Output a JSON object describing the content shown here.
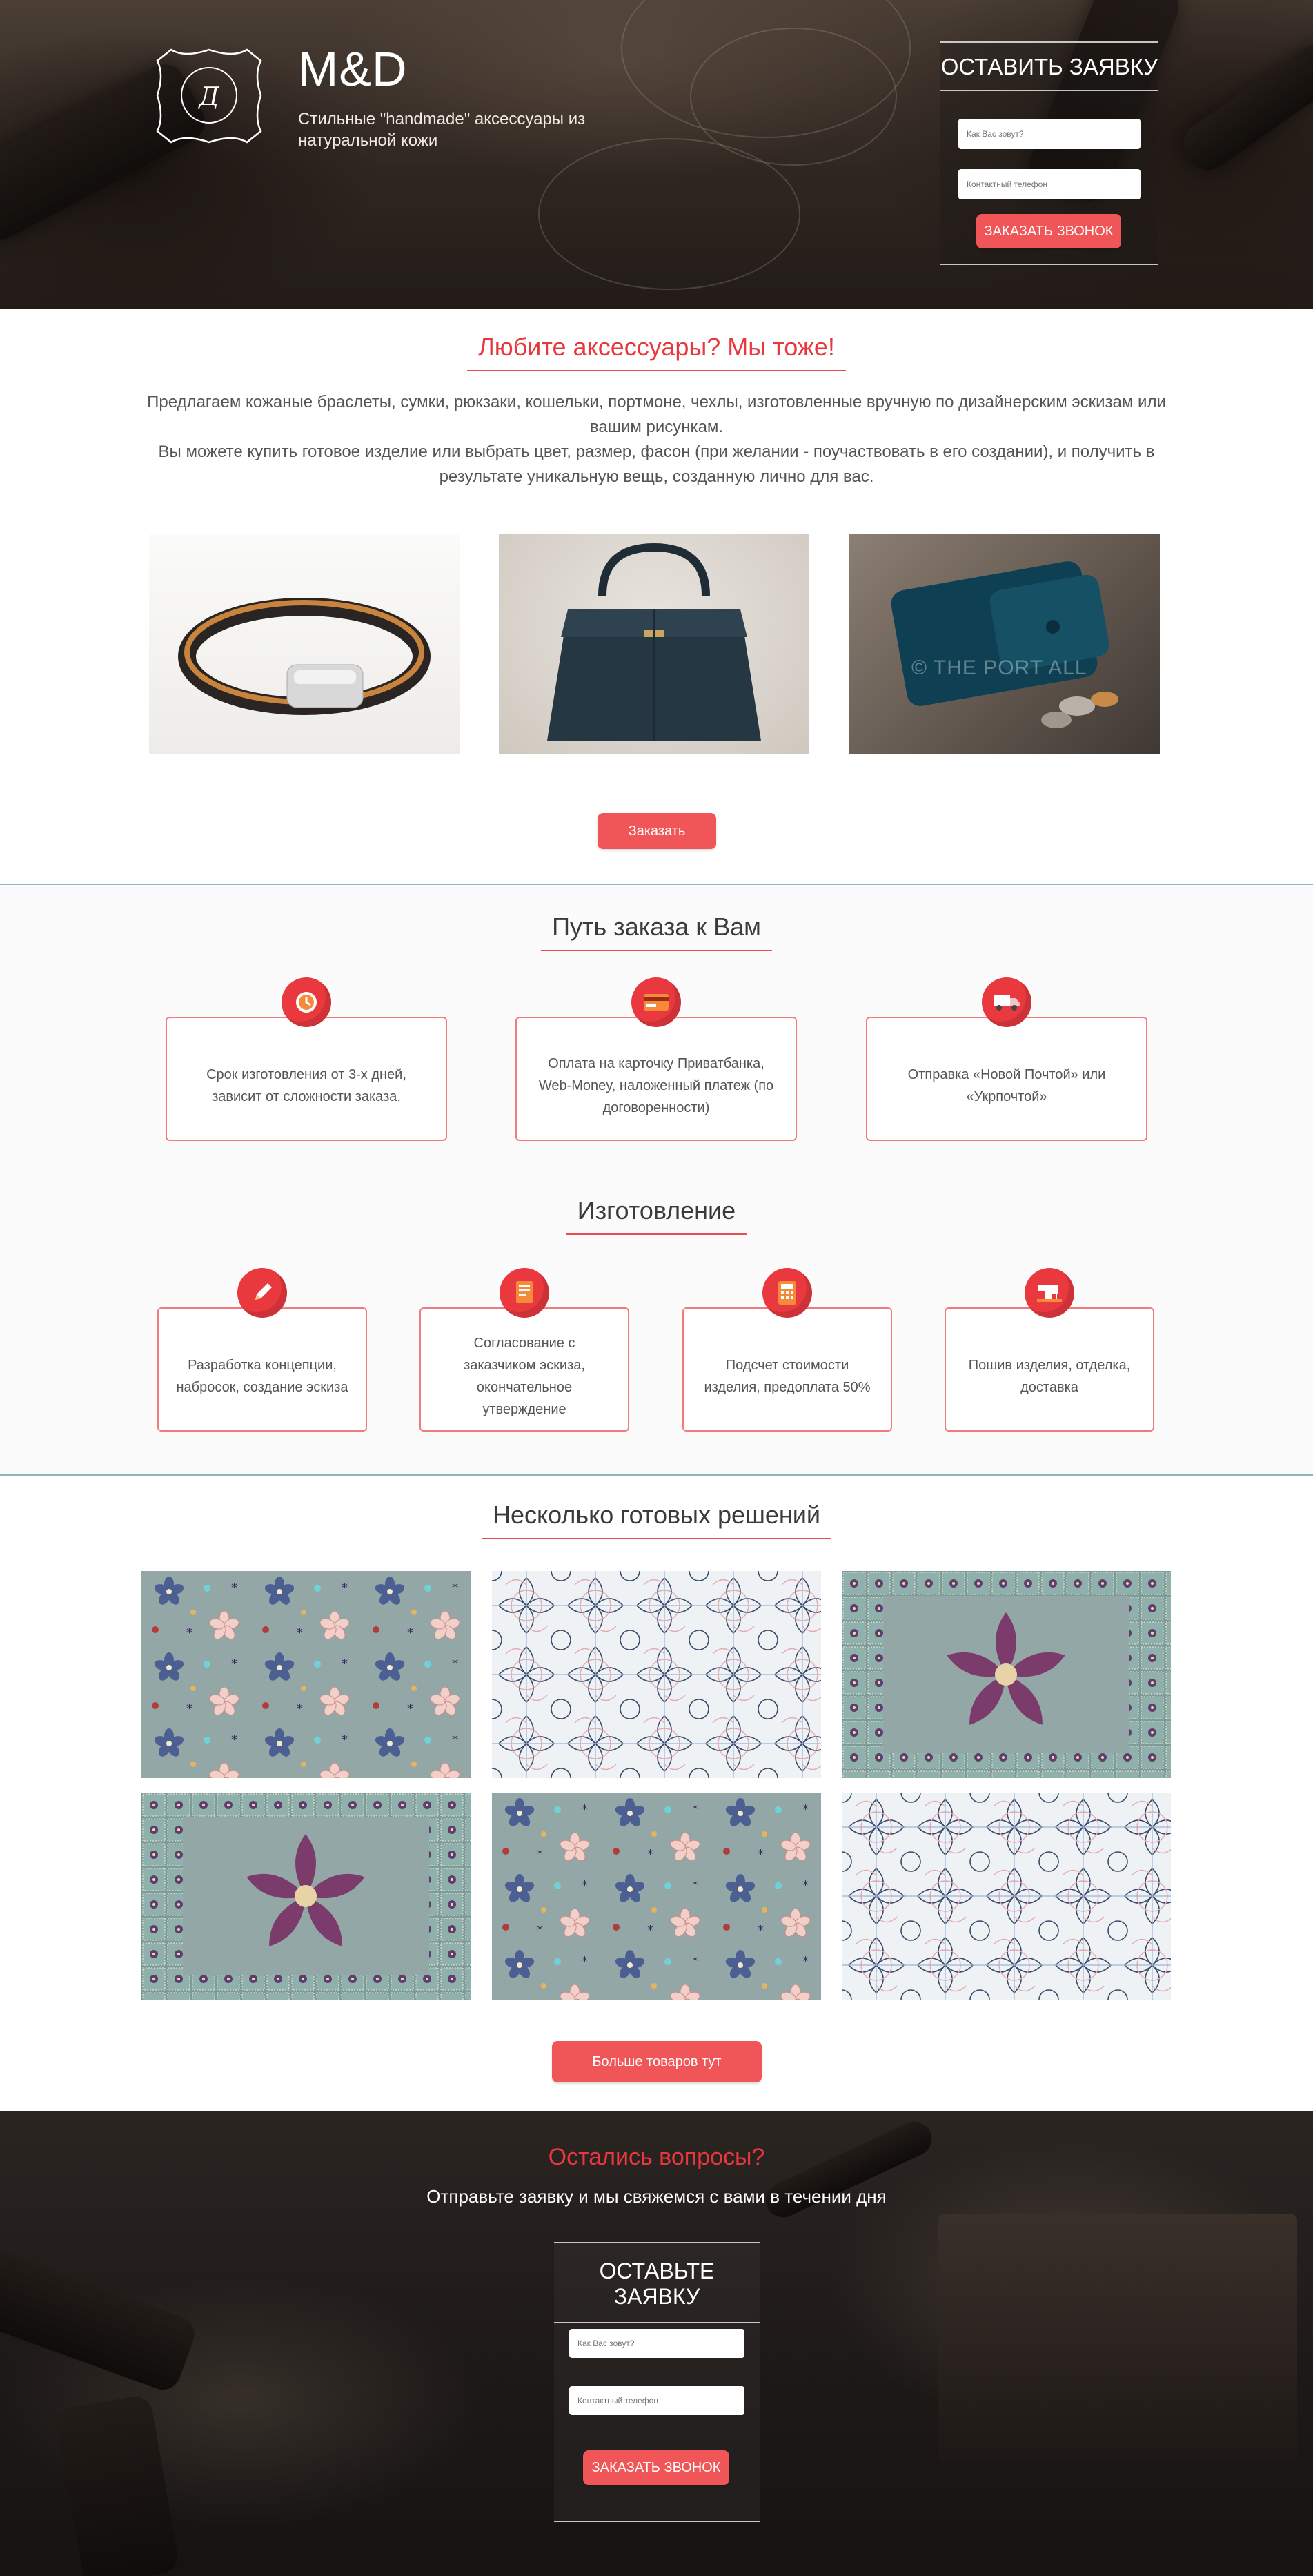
{
  "header": {
    "brand_name": "M&D",
    "tagline": "Стильные \"handmade\" аксессуары из натуральной кожи",
    "form": {
      "title": "ОСТАВИТЬ ЗАЯВКУ",
      "name_placeholder": "Как Вас зовут?",
      "phone_placeholder": "Контактный телефон",
      "submit_label": "ЗАКАЗАТЬ ЗВОНОК"
    }
  },
  "intro": {
    "title": "Любите аксессуары? Мы тоже!",
    "paragraph_1": "Предлагаем кожаные браслеты, сумки, рюкзаки, кошельки, портмоне, чехлы, изготовленные вручную по дизайнерским эскизам или вашим рисункам.",
    "paragraph_2": "Вы можете купить готовое изделие или выбрать цвет, размер, фасон (при желании - поучаствовать в его создании), и получить в результате уникальную вещь, созданную лично для вас.",
    "photos": [
      {
        "name": "bracelet",
        "watermark": ""
      },
      {
        "name": "bag",
        "watermark": ""
      },
      {
        "name": "wallet",
        "watermark": "© THE PORT ALL"
      }
    ],
    "order_button": "Заказать"
  },
  "delivery": {
    "title": "Путь заказа к Вам",
    "cards": [
      {
        "icon": "clock-icon",
        "text": "Срок изготовления от 3-х дней, зависит от сложности заказа."
      },
      {
        "icon": "credit-card-icon",
        "text": "Оплата на карточку Приватбанка, Web-Money, наложенный платеж (по договоренности)"
      },
      {
        "icon": "truck-icon",
        "text": "Отправка «Новой Почтой» или «Укрпочтой»"
      }
    ]
  },
  "production": {
    "title": "Изготовление",
    "cards": [
      {
        "icon": "pencil-icon",
        "text": "Разработка концепции, набросок, создание эскиза"
      },
      {
        "icon": "document-icon",
        "text": "Согласование с заказчиком эскиза, окончательное утверждение"
      },
      {
        "icon": "calculator-icon",
        "text": "Подсчет стоимости изделия, предоплата 50%"
      },
      {
        "icon": "sewing-machine-icon",
        "text": "Пошив изделия, отделка, доставка"
      }
    ]
  },
  "solutions": {
    "title": "Несколько готовых решений",
    "more_button": "Больше товаров тут"
  },
  "footer": {
    "question": "Остались вопросы?",
    "subtitle": "Отправьте заявку и мы свяжемся с вами в течении дня",
    "form": {
      "title": "ОСТАВЬТЕ ЗАЯВКУ",
      "name_placeholder": "Как Вас зовут?",
      "phone_placeholder": "Контактный телефон",
      "submit_label": "ЗАКАЗАТЬ ЗВОНОК"
    }
  },
  "colors": {
    "accent": "#e8383d",
    "button": "#f05558",
    "divider": "#8fb3c2",
    "pattern_bg": "#94a7a7"
  }
}
